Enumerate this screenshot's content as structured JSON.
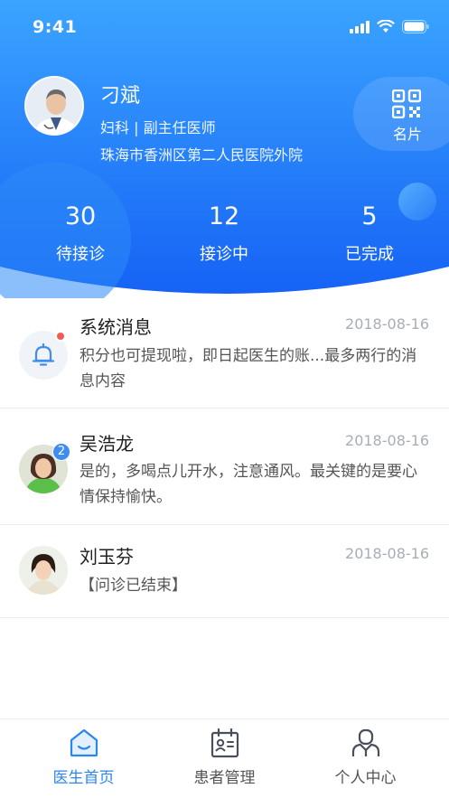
{
  "status_bar": {
    "time": "9:41"
  },
  "doctor": {
    "name": "刁斌",
    "title": "妇科 | 副主任医师",
    "hospital": "珠海市香洲区第二人民医院外院",
    "card_label": "名片"
  },
  "stats": [
    {
      "value": "30",
      "label": "待接诊"
    },
    {
      "value": "12",
      "label": "接诊中"
    },
    {
      "value": "5",
      "label": "已完成"
    }
  ],
  "messages": [
    {
      "name": "系统消息",
      "date": "2018-08-16",
      "text": "积分也可提现啦，即日起医生的账...最多两行的消息内容",
      "avatar_icon": "bell-icon",
      "unread_dot": true
    },
    {
      "name": "吴浩龙",
      "date": "2018-08-16",
      "text": "是的，多喝点儿开水，注意通风。最关键的是要心情保持愉快。",
      "badge": "2"
    },
    {
      "name": "刘玉芬",
      "date": "2018-08-16",
      "text": "【问诊已结束】"
    }
  ],
  "tabs": [
    {
      "label": "医生首页",
      "icon": "home-icon",
      "active": true
    },
    {
      "label": "患者管理",
      "icon": "patient-card-icon",
      "active": false
    },
    {
      "label": "个人中心",
      "icon": "person-icon",
      "active": false
    }
  ],
  "colors": {
    "primary": "#2b86f0",
    "header_top": "#3aa4ff",
    "header_bottom": "#1662f5",
    "badge": "#3d8df2",
    "dot": "#f05b55"
  }
}
